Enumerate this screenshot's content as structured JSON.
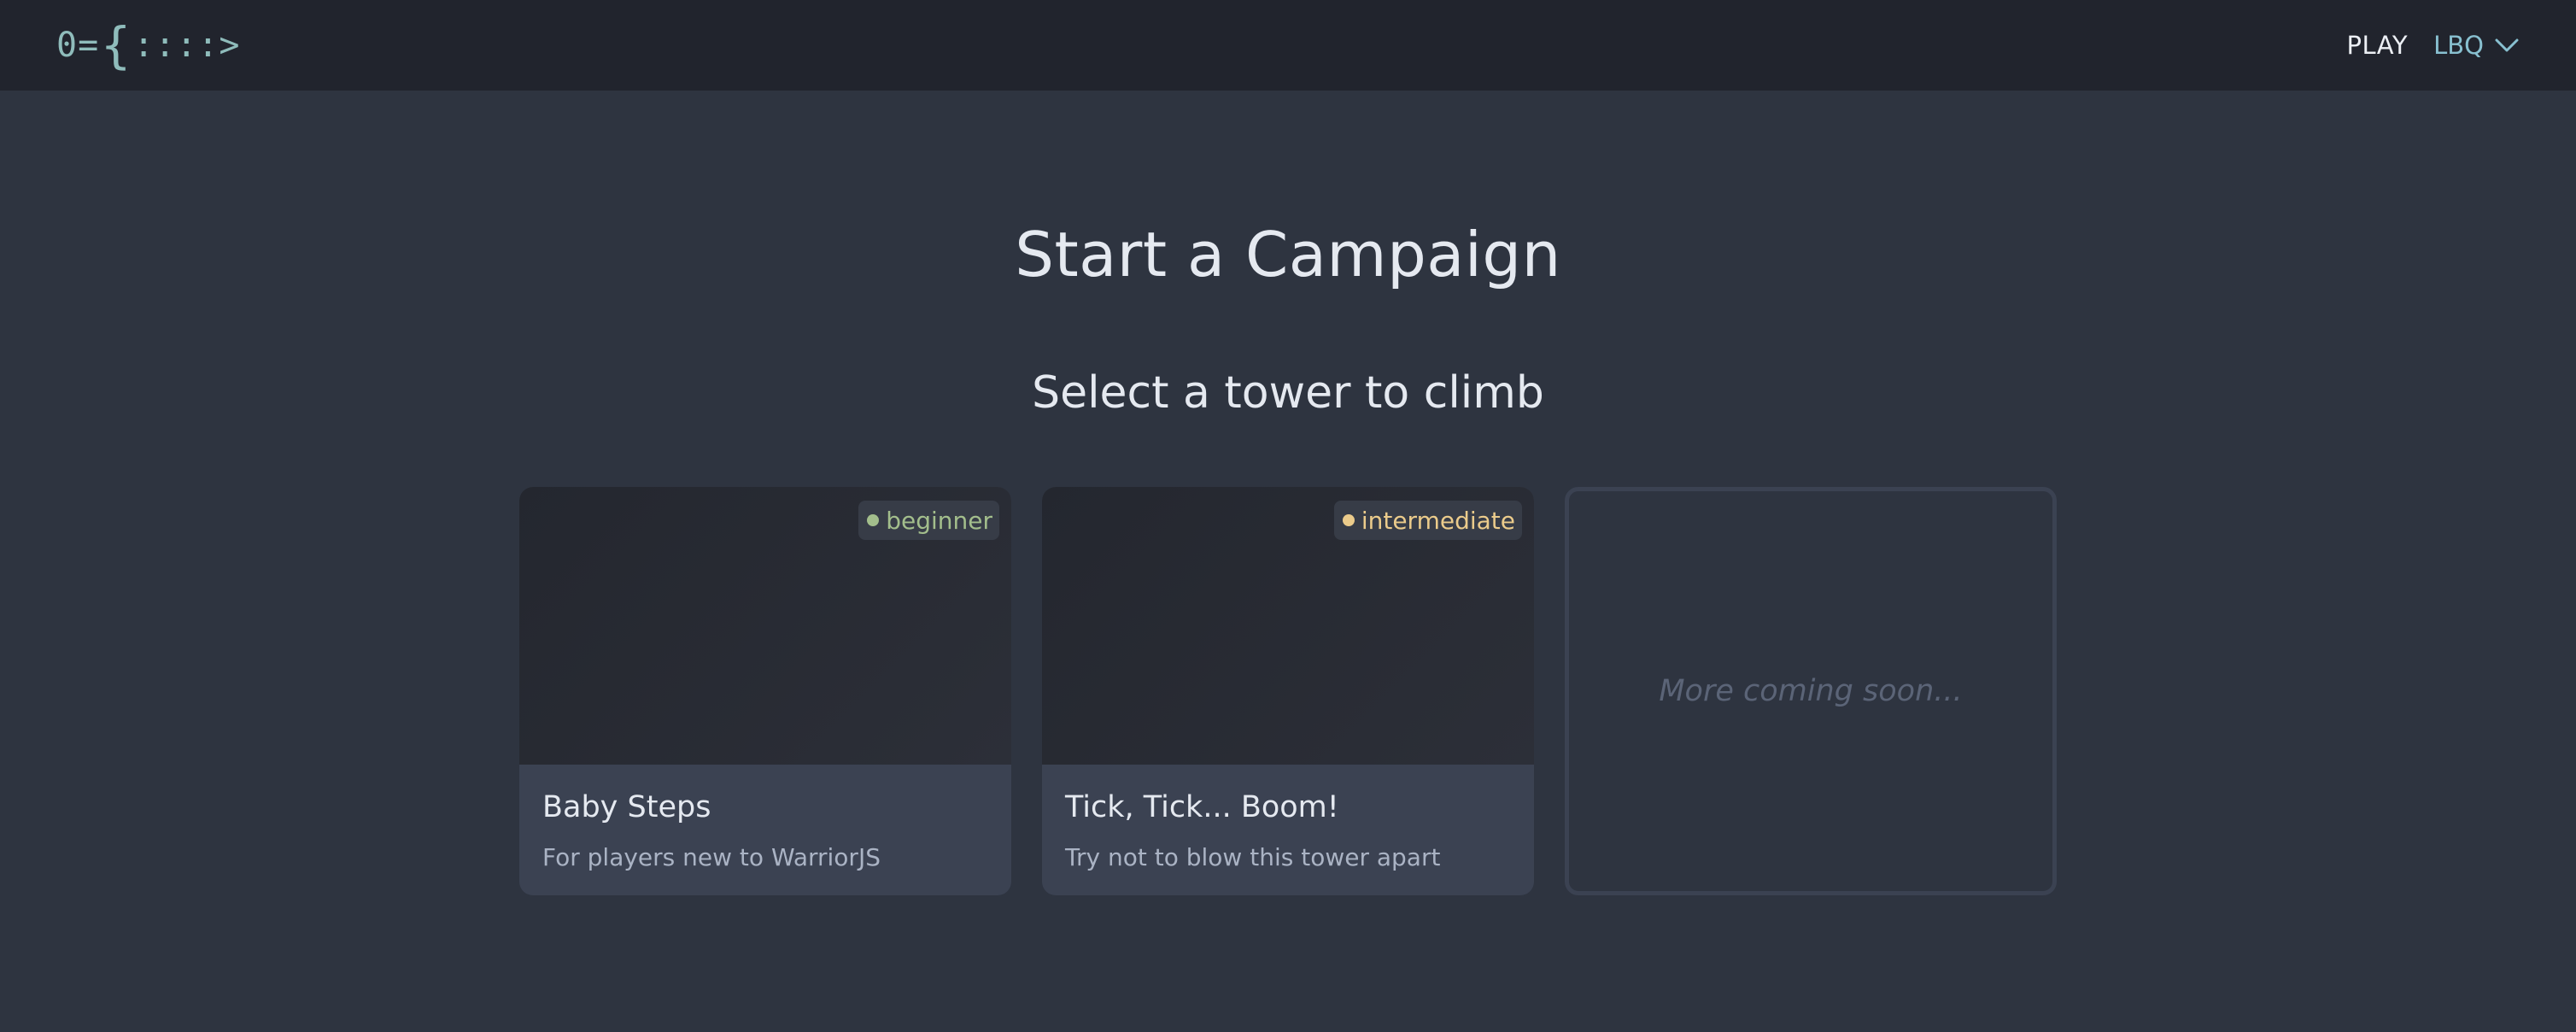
{
  "header": {
    "logo": {
      "left": "0=",
      "brace": "{",
      "dots": "::::",
      "tip": ">"
    },
    "nav": {
      "play": "PLAY",
      "user": "LBQ"
    }
  },
  "main": {
    "title": "Start a Campaign",
    "subtitle": "Select a tower to climb",
    "towers": [
      {
        "badge": "beginner",
        "name": "Baby Steps",
        "description": "For players new to WarriorJS"
      },
      {
        "badge": "intermediate",
        "name": "Tick, Tick... Boom!",
        "description": "Try not to blow this tower apart"
      }
    ],
    "placeholder": "More coming soon..."
  },
  "colors": {
    "background": "#2e3440",
    "header": "#21242d",
    "card": "#3b4252",
    "accent": "#88c0d0",
    "beginner": "#a3be8c",
    "intermediate": "#ebcb8b"
  }
}
